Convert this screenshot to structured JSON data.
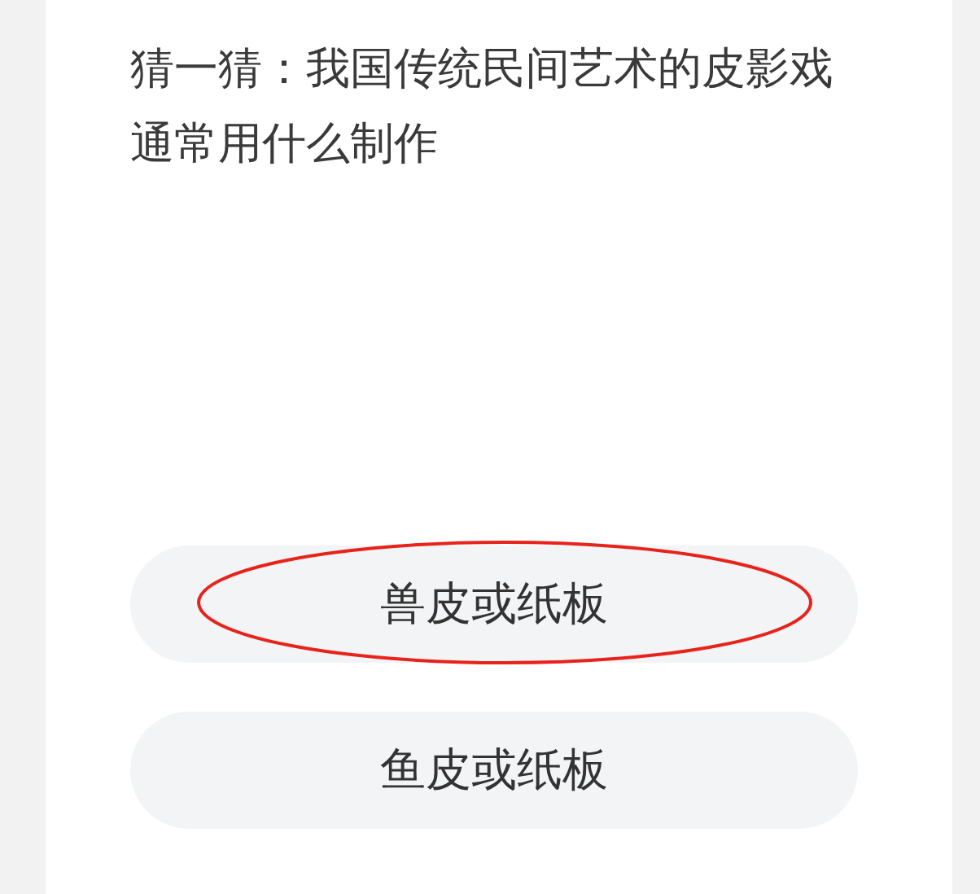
{
  "question": "猜一猜：我国传统民间艺术的皮影戏通常用什么制作",
  "options": [
    {
      "label": "兽皮或纸板",
      "circled": true
    },
    {
      "label": "鱼皮或纸板",
      "circled": false
    }
  ]
}
